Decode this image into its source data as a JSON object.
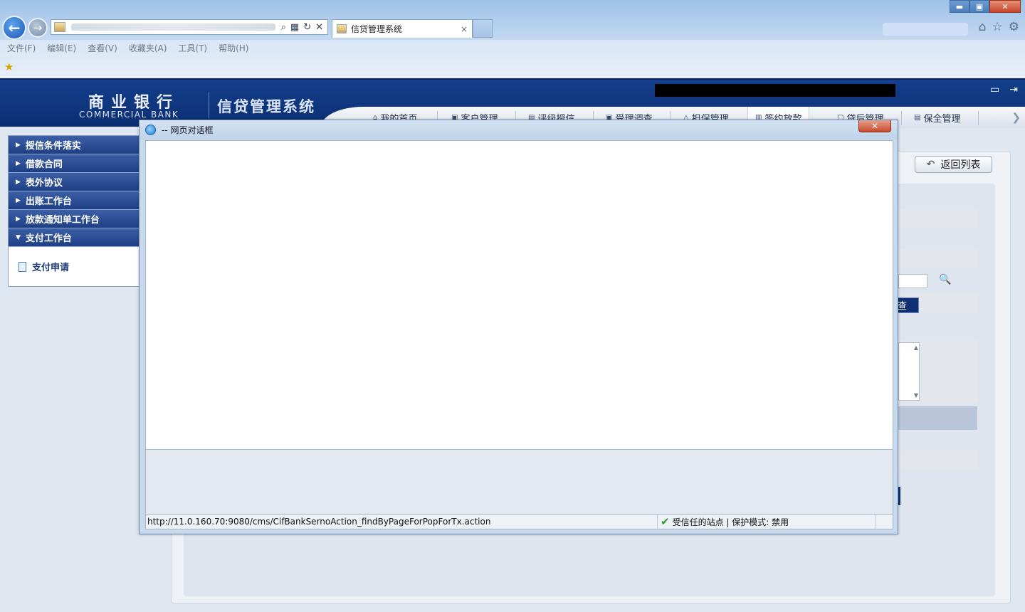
{
  "browser": {
    "tab_title": "信贷管理系统",
    "tab_close": "×",
    "menu": [
      "文件(F)",
      "编辑(E)",
      "查看(V)",
      "收藏夹(A)",
      "工具(T)",
      "帮助(H)"
    ],
    "window_controls": {
      "minimize": "▬",
      "maximize": "▣",
      "close": "✕"
    },
    "icons": {
      "back": "back-arrow-icon",
      "forward": "forward-arrow-icon",
      "home": "home-icon",
      "favorites": "star-icon",
      "settings": "gear-icon"
    }
  },
  "header": {
    "brand_cn": "商业银行",
    "brand_en": "COMMERCIAL BANK",
    "system_title": "信贷管理系统"
  },
  "nav": {
    "tabs": [
      {
        "label": "我的首页",
        "icon": "home-icon"
      },
      {
        "label": "客户管理",
        "icon": "customer-icon"
      },
      {
        "label": "评级授信",
        "icon": "rating-icon"
      },
      {
        "label": "受理调查",
        "icon": "survey-icon"
      },
      {
        "label": "担保管理",
        "icon": "guarantee-icon"
      },
      {
        "label": "签约放款",
        "icon": "contract-icon",
        "active": true
      },
      {
        "label": "贷后管理",
        "icon": "postloan-icon"
      },
      {
        "label": "保全管理",
        "icon": "preservation-icon"
      }
    ]
  },
  "sidebar": {
    "items": [
      {
        "label": "授信条件落实",
        "expanded": false
      },
      {
        "label": "借款合同",
        "expanded": false
      },
      {
        "label": "表外协议",
        "expanded": false
      },
      {
        "label": "出账工作台",
        "expanded": false
      },
      {
        "label": "放款通知单工作台",
        "expanded": false
      },
      {
        "label": "支付工作台",
        "expanded": true
      }
    ],
    "sub_items": [
      {
        "label": "支付申请"
      }
    ]
  },
  "content": {
    "back_button": "返回列表",
    "query_fragment": "查"
  },
  "dialog": {
    "title": "-- 网页对话框",
    "close": "✕",
    "status_url": "http://11.0.160.70:9080/cms/CifBankSernoAction_findByPageForPopForTx.action",
    "status_zone": "受信任的站点 | 保护模式: 禁用"
  }
}
